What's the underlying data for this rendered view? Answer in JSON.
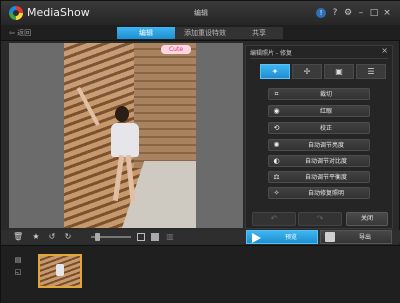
{
  "app": {
    "title": "MediaShow",
    "mode": "编辑"
  },
  "nav": {
    "back_label": "返回",
    "tabs": [
      {
        "label": "编辑",
        "active": true
      },
      {
        "label": "添加重设特效",
        "active": false
      },
      {
        "label": "共享",
        "active": false
      }
    ]
  },
  "photo": {
    "sticker_text": "Cute"
  },
  "panel": {
    "title": "编辑照片 - 修复",
    "close_glyph": "×",
    "tabs": [
      "✦",
      "✢",
      "▣",
      "☰"
    ],
    "tools": [
      {
        "label": "裁切",
        "icon": "crop-icon",
        "glyph": "⌗"
      },
      {
        "label": "红眼",
        "icon": "eye-icon",
        "glyph": "◉"
      },
      {
        "label": "校正",
        "icon": "rotate-icon",
        "glyph": "⟲"
      },
      {
        "label": "自动调节亮度",
        "icon": "brightness-icon",
        "glyph": "✺"
      },
      {
        "label": "自动调节对比度",
        "icon": "contrast-icon",
        "glyph": "◐"
      },
      {
        "label": "自动调节平衡度",
        "icon": "balance-icon",
        "glyph": "⚖"
      },
      {
        "label": "自动修复照明",
        "icon": "lighting-icon",
        "glyph": "✧"
      }
    ],
    "undo_glyph": "↶",
    "redo_glyph": "↷",
    "close_label": "关闭"
  },
  "window_controls": {
    "info": "!",
    "help": "?",
    "settings": "⚙",
    "minimize": "–",
    "maximize": "□",
    "close": "×"
  },
  "toolbar": {
    "icons": [
      "🗑",
      "★",
      "↺",
      "↻"
    ],
    "play_label": "预览",
    "export_label": "导出"
  },
  "filmstrip": {
    "icons": [
      "▤",
      "◱"
    ]
  }
}
